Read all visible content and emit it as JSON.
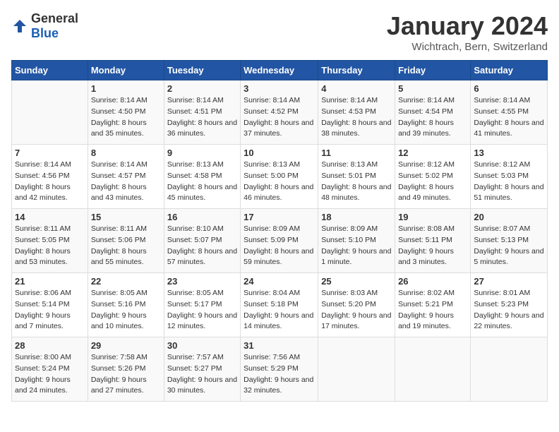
{
  "logo": {
    "general": "General",
    "blue": "Blue"
  },
  "title": "January 2024",
  "subtitle": "Wichtrach, Bern, Switzerland",
  "weekdays": [
    "Sunday",
    "Monday",
    "Tuesday",
    "Wednesday",
    "Thursday",
    "Friday",
    "Saturday"
  ],
  "weeks": [
    [
      {
        "day": "",
        "sunrise": "",
        "sunset": "",
        "daylight": ""
      },
      {
        "day": "1",
        "sunrise": "Sunrise: 8:14 AM",
        "sunset": "Sunset: 4:50 PM",
        "daylight": "Daylight: 8 hours and 35 minutes."
      },
      {
        "day": "2",
        "sunrise": "Sunrise: 8:14 AM",
        "sunset": "Sunset: 4:51 PM",
        "daylight": "Daylight: 8 hours and 36 minutes."
      },
      {
        "day": "3",
        "sunrise": "Sunrise: 8:14 AM",
        "sunset": "Sunset: 4:52 PM",
        "daylight": "Daylight: 8 hours and 37 minutes."
      },
      {
        "day": "4",
        "sunrise": "Sunrise: 8:14 AM",
        "sunset": "Sunset: 4:53 PM",
        "daylight": "Daylight: 8 hours and 38 minutes."
      },
      {
        "day": "5",
        "sunrise": "Sunrise: 8:14 AM",
        "sunset": "Sunset: 4:54 PM",
        "daylight": "Daylight: 8 hours and 39 minutes."
      },
      {
        "day": "6",
        "sunrise": "Sunrise: 8:14 AM",
        "sunset": "Sunset: 4:55 PM",
        "daylight": "Daylight: 8 hours and 41 minutes."
      }
    ],
    [
      {
        "day": "7",
        "sunrise": "Sunrise: 8:14 AM",
        "sunset": "Sunset: 4:56 PM",
        "daylight": "Daylight: 8 hours and 42 minutes."
      },
      {
        "day": "8",
        "sunrise": "Sunrise: 8:14 AM",
        "sunset": "Sunset: 4:57 PM",
        "daylight": "Daylight: 8 hours and 43 minutes."
      },
      {
        "day": "9",
        "sunrise": "Sunrise: 8:13 AM",
        "sunset": "Sunset: 4:58 PM",
        "daylight": "Daylight: 8 hours and 45 minutes."
      },
      {
        "day": "10",
        "sunrise": "Sunrise: 8:13 AM",
        "sunset": "Sunset: 5:00 PM",
        "daylight": "Daylight: 8 hours and 46 minutes."
      },
      {
        "day": "11",
        "sunrise": "Sunrise: 8:13 AM",
        "sunset": "Sunset: 5:01 PM",
        "daylight": "Daylight: 8 hours and 48 minutes."
      },
      {
        "day": "12",
        "sunrise": "Sunrise: 8:12 AM",
        "sunset": "Sunset: 5:02 PM",
        "daylight": "Daylight: 8 hours and 49 minutes."
      },
      {
        "day": "13",
        "sunrise": "Sunrise: 8:12 AM",
        "sunset": "Sunset: 5:03 PM",
        "daylight": "Daylight: 8 hours and 51 minutes."
      }
    ],
    [
      {
        "day": "14",
        "sunrise": "Sunrise: 8:11 AM",
        "sunset": "Sunset: 5:05 PM",
        "daylight": "Daylight: 8 hours and 53 minutes."
      },
      {
        "day": "15",
        "sunrise": "Sunrise: 8:11 AM",
        "sunset": "Sunset: 5:06 PM",
        "daylight": "Daylight: 8 hours and 55 minutes."
      },
      {
        "day": "16",
        "sunrise": "Sunrise: 8:10 AM",
        "sunset": "Sunset: 5:07 PM",
        "daylight": "Daylight: 8 hours and 57 minutes."
      },
      {
        "day": "17",
        "sunrise": "Sunrise: 8:09 AM",
        "sunset": "Sunset: 5:09 PM",
        "daylight": "Daylight: 8 hours and 59 minutes."
      },
      {
        "day": "18",
        "sunrise": "Sunrise: 8:09 AM",
        "sunset": "Sunset: 5:10 PM",
        "daylight": "Daylight: 9 hours and 1 minute."
      },
      {
        "day": "19",
        "sunrise": "Sunrise: 8:08 AM",
        "sunset": "Sunset: 5:11 PM",
        "daylight": "Daylight: 9 hours and 3 minutes."
      },
      {
        "day": "20",
        "sunrise": "Sunrise: 8:07 AM",
        "sunset": "Sunset: 5:13 PM",
        "daylight": "Daylight: 9 hours and 5 minutes."
      }
    ],
    [
      {
        "day": "21",
        "sunrise": "Sunrise: 8:06 AM",
        "sunset": "Sunset: 5:14 PM",
        "daylight": "Daylight: 9 hours and 7 minutes."
      },
      {
        "day": "22",
        "sunrise": "Sunrise: 8:05 AM",
        "sunset": "Sunset: 5:16 PM",
        "daylight": "Daylight: 9 hours and 10 minutes."
      },
      {
        "day": "23",
        "sunrise": "Sunrise: 8:05 AM",
        "sunset": "Sunset: 5:17 PM",
        "daylight": "Daylight: 9 hours and 12 minutes."
      },
      {
        "day": "24",
        "sunrise": "Sunrise: 8:04 AM",
        "sunset": "Sunset: 5:18 PM",
        "daylight": "Daylight: 9 hours and 14 minutes."
      },
      {
        "day": "25",
        "sunrise": "Sunrise: 8:03 AM",
        "sunset": "Sunset: 5:20 PM",
        "daylight": "Daylight: 9 hours and 17 minutes."
      },
      {
        "day": "26",
        "sunrise": "Sunrise: 8:02 AM",
        "sunset": "Sunset: 5:21 PM",
        "daylight": "Daylight: 9 hours and 19 minutes."
      },
      {
        "day": "27",
        "sunrise": "Sunrise: 8:01 AM",
        "sunset": "Sunset: 5:23 PM",
        "daylight": "Daylight: 9 hours and 22 minutes."
      }
    ],
    [
      {
        "day": "28",
        "sunrise": "Sunrise: 8:00 AM",
        "sunset": "Sunset: 5:24 PM",
        "daylight": "Daylight: 9 hours and 24 minutes."
      },
      {
        "day": "29",
        "sunrise": "Sunrise: 7:58 AM",
        "sunset": "Sunset: 5:26 PM",
        "daylight": "Daylight: 9 hours and 27 minutes."
      },
      {
        "day": "30",
        "sunrise": "Sunrise: 7:57 AM",
        "sunset": "Sunset: 5:27 PM",
        "daylight": "Daylight: 9 hours and 30 minutes."
      },
      {
        "day": "31",
        "sunrise": "Sunrise: 7:56 AM",
        "sunset": "Sunset: 5:29 PM",
        "daylight": "Daylight: 9 hours and 32 minutes."
      },
      {
        "day": "",
        "sunrise": "",
        "sunset": "",
        "daylight": ""
      },
      {
        "day": "",
        "sunrise": "",
        "sunset": "",
        "daylight": ""
      },
      {
        "day": "",
        "sunrise": "",
        "sunset": "",
        "daylight": ""
      }
    ]
  ]
}
